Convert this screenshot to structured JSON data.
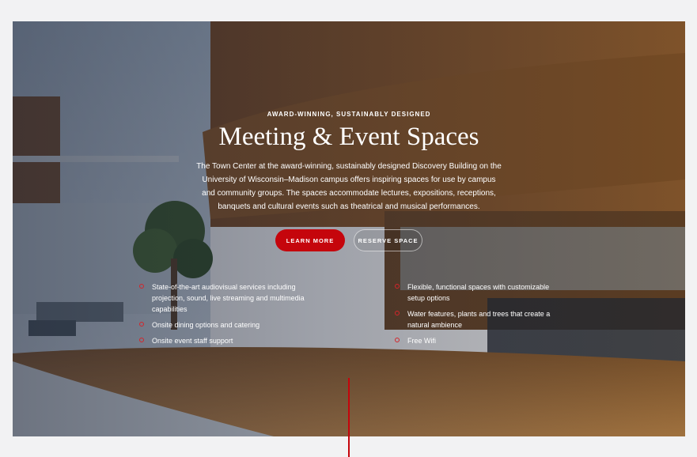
{
  "hero": {
    "eyebrow": "AWARD-WINNING, SUSTAINABLY DESIGNED",
    "title": "Meeting & Event Spaces",
    "description": "The Town Center at the award-winning, sustainably designed Discovery Building on the University of Wisconsin–Madison campus offers inspiring spaces for use by campus and community groups. The spaces accommodate lectures, expositions, receptions, banquets and cultural events such as theatrical and musical performances.",
    "buttons": {
      "primary": "LEARN MORE",
      "secondary": "RESERVE SPACE"
    },
    "features_left": [
      "State-of-the-art audiovisual services including projection, sound, live streaming and multimedia capabilities",
      "Onsite dining options and catering",
      "Onsite event staff support"
    ],
    "features_right": [
      "Flexible, functional spaces with customizable setup options",
      "Water features, plants and trees that create a natural ambience",
      "Free Wifi"
    ]
  },
  "colors": {
    "accent": "#c5050c",
    "page_background": "#f2f2f3",
    "bullet": "#d4242a"
  },
  "icons": {
    "bullet": "circle-bullet-icon"
  }
}
